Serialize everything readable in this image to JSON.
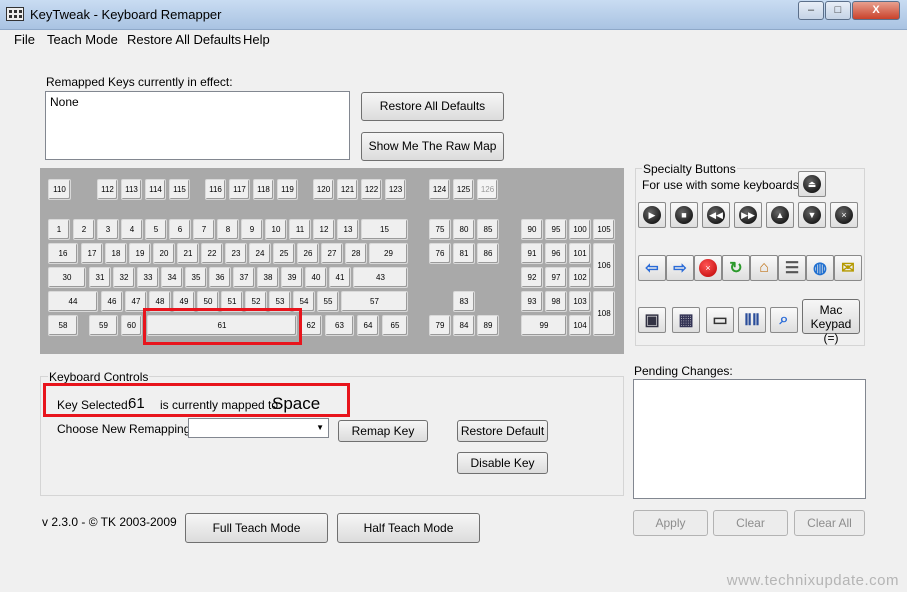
{
  "window": {
    "title": "KeyTweak -  Keyboard Remapper",
    "minimize": "–",
    "maximize": "□",
    "close": "X"
  },
  "menu": {
    "file": "File",
    "teach": "Teach Mode",
    "restore": "Restore All Defaults",
    "help": "Help"
  },
  "remapped": {
    "label": "Remapped Keys currently in effect:",
    "value": "None"
  },
  "buttons": {
    "restore_all": "Restore All Defaults",
    "raw_map": "Show Me The Raw Map",
    "remap": "Remap Key",
    "restore_default": "Restore Default",
    "disable": "Disable Key",
    "full_teach": "Full Teach Mode",
    "half_teach": "Half Teach Mode",
    "apply": "Apply",
    "clear": "Clear",
    "clear_all": "Clear All"
  },
  "keyboard_keys": [
    "110",
    "112",
    "113",
    "114",
    "115",
    "116",
    "117",
    "118",
    "119",
    "120",
    "121",
    "122",
    "123",
    "124",
    "125",
    "126",
    "1",
    "2",
    "3",
    "4",
    "5",
    "6",
    "7",
    "8",
    "9",
    "10",
    "11",
    "12",
    "13",
    "15",
    "75",
    "80",
    "85",
    "90",
    "95",
    "100",
    "105",
    "16",
    "17",
    "18",
    "19",
    "20",
    "21",
    "22",
    "23",
    "24",
    "25",
    "26",
    "27",
    "28",
    "29",
    "76",
    "81",
    "86",
    "91",
    "96",
    "101",
    "106",
    "30",
    "31",
    "32",
    "33",
    "34",
    "35",
    "36",
    "37",
    "38",
    "39",
    "40",
    "41",
    "43",
    "92",
    "97",
    "102",
    "44",
    "46",
    "47",
    "48",
    "49",
    "50",
    "51",
    "52",
    "53",
    "54",
    "55",
    "57",
    "83",
    "93",
    "98",
    "103",
    "108",
    "58",
    "59",
    "60",
    "61",
    "62",
    "63",
    "64",
    "65",
    "79",
    "84",
    "89",
    "99",
    "104"
  ],
  "specialty": {
    "title": "Specialty Buttons",
    "subtitle": "For use with some keyboards",
    "mac_keypad": "Mac\nKeypad (=)",
    "icons": [
      "eject-icon",
      "play-icon",
      "stop-icon",
      "rewind-icon",
      "fast-forward-icon",
      "volume-up-icon",
      "volume-down-icon",
      "mute-icon",
      "back-arrow-icon",
      "forward-arrow-icon",
      "stop-red-icon",
      "refresh-icon",
      "home-icon",
      "favorites-icon",
      "web-globe-icon",
      "mail-icon",
      "my-computer-icon",
      "calculator-icon",
      "monitor-icon",
      "media-icon",
      "search-magnifier-icon"
    ]
  },
  "controls": {
    "title": "Keyboard Controls",
    "key_selected_label": "Key Selected:",
    "key_selected_value": "61",
    "mapped_label": "is currently mapped to:",
    "mapped_value": "Space",
    "choose_label": "Choose New Remapping"
  },
  "pending": {
    "label": "Pending Changes:"
  },
  "version": "v 2.3.0 - © TK 2003-2009",
  "watermark": "www.technixupdate.com"
}
